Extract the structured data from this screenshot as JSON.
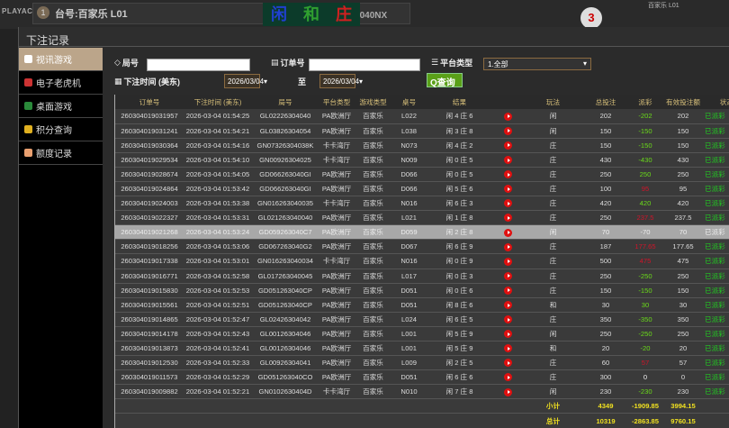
{
  "background": {
    "logo": "PLAYACE",
    "table_no": "1",
    "table_name": "台号:百家乐 L01",
    "round_no": "游戏局号:GL001263040NX",
    "tiles": [
      "闲",
      "和",
      "庄"
    ],
    "countdown": "3",
    "right_table": "百家乐 L01"
  },
  "modal": {
    "title": "下注记录"
  },
  "sidebar": {
    "items": [
      {
        "label": "视讯游戏",
        "icon": "cards-icon",
        "active": true
      },
      {
        "label": "电子老虎机",
        "icon": "slot-icon"
      },
      {
        "label": "桌面游戏",
        "icon": "dice-icon"
      },
      {
        "label": "积分查询",
        "icon": "diamond-icon"
      },
      {
        "label": "额度记录",
        "icon": "document-icon"
      }
    ]
  },
  "filters": {
    "round_label": "局号",
    "round_value": "",
    "order_label": "订单号",
    "order_value": "",
    "platform_label": "平台类型",
    "platform_value": "1.全部",
    "time_label": "下注时间 (美东)",
    "date_from": "2026/03/04",
    "date_to": "2026/03/04",
    "to_label": "至",
    "query_label": "查询"
  },
  "colors": {
    "positive": "#6adb1a",
    "negative": "#d0142a",
    "header": "#d8c07a",
    "status": "#22cc22",
    "query": "#5aa018"
  },
  "table": {
    "headers": [
      "订单号",
      "下注时间 (美东)",
      "局号",
      "平台类型",
      "游戏类型",
      "桌号",
      "结果",
      "",
      "玩法",
      "总投注",
      "派彩",
      "有效投注额",
      "状态"
    ],
    "rows": [
      [
        "260304019031957",
        "2026-03-04 01:54:25",
        "GL02226304040",
        "PA欧洲厅",
        "百家乐",
        "L022",
        "闲 4 庄 6",
        "闲",
        "202",
        "-202",
        "202",
        "已派彩",
        "pos"
      ],
      [
        "260304019031241",
        "2026-03-04 01:54:21",
        "GL03826304054",
        "PA欧洲厅",
        "百家乐",
        "L038",
        "闲 3 庄 8",
        "闲",
        "150",
        "-150",
        "150",
        "已派彩",
        "pos"
      ],
      [
        "260304019030364",
        "2026-03-04 01:54:16",
        "GN07326304038K",
        "卡卡湾厅",
        "百家乐",
        "N073",
        "闲 4 庄 2",
        "庄",
        "150",
        "-150",
        "150",
        "已派彩",
        "pos"
      ],
      [
        "260304019029534",
        "2026-03-04 01:54:10",
        "GN00926304025",
        "卡卡湾厅",
        "百家乐",
        "N009",
        "闲 0 庄 5",
        "庄",
        "430",
        "-430",
        "430",
        "已派彩",
        "pos"
      ],
      [
        "260304019028674",
        "2026-03-04 01:54:05",
        "GD066263040GI",
        "PA欧洲厅",
        "百家乐",
        "D066",
        "闲 0 庄 5",
        "庄",
        "250",
        "250",
        "250",
        "已派彩",
        "pos"
      ],
      [
        "260304019024864",
        "2026-03-04 01:53:42",
        "GD066263040GI",
        "PA欧洲厅",
        "百家乐",
        "D066",
        "闲 5 庄 6",
        "庄",
        "100",
        "95",
        "95",
        "已派彩",
        "neg"
      ],
      [
        "260304019024003",
        "2026-03-04 01:53:38",
        "GN016263040035",
        "卡卡湾厅",
        "百家乐",
        "N016",
        "闲 6 庄 3",
        "庄",
        "420",
        "420",
        "420",
        "已派彩",
        "pos"
      ],
      [
        "260304019022327",
        "2026-03-04 01:53:31",
        "GL021263040040",
        "PA欧洲厅",
        "百家乐",
        "L021",
        "闲 1 庄 8",
        "庄",
        "250",
        "237.5",
        "237.5",
        "已派彩",
        "neg"
      ],
      [
        "260304019021268",
        "2026-03-04 01:53:24",
        "GD059263040C7",
        "PA欧洲厅",
        "百家乐",
        "D059",
        "闲 2 庄 8",
        "闲",
        "70",
        "-70",
        "70",
        "已派彩",
        "pos"
      ],
      [
        "260304019018256",
        "2026-03-04 01:53:06",
        "GD067263040G2",
        "PA欧洲厅",
        "百家乐",
        "D067",
        "闲 6 庄 9",
        "庄",
        "187",
        "177.65",
        "177.65",
        "已派彩",
        "neg"
      ],
      [
        "260304019017338",
        "2026-03-04 01:53:01",
        "GN016263040034",
        "卡卡湾厅",
        "百家乐",
        "N016",
        "闲 0 庄 9",
        "庄",
        "500",
        "475",
        "475",
        "已派彩",
        "neg"
      ],
      [
        "260304019016771",
        "2026-03-04 01:52:58",
        "GL017263040045",
        "PA欧洲厅",
        "百家乐",
        "L017",
        "闲 0 庄 3",
        "庄",
        "250",
        "-250",
        "250",
        "已派彩",
        "pos"
      ],
      [
        "260304019015830",
        "2026-03-04 01:52:53",
        "GD051263040CP",
        "PA欧洲厅",
        "百家乐",
        "D051",
        "闲 0 庄 6",
        "庄",
        "150",
        "-150",
        "150",
        "已派彩",
        "pos"
      ],
      [
        "260304019015561",
        "2026-03-04 01:52:51",
        "GD051263040CP",
        "PA欧洲厅",
        "百家乐",
        "D051",
        "闲 8 庄 6",
        "和",
        "30",
        "30",
        "30",
        "已派彩",
        "pos"
      ],
      [
        "260304019014865",
        "2026-03-04 01:52:47",
        "GL02426304042",
        "PA欧洲厅",
        "百家乐",
        "L024",
        "闲 6 庄 5",
        "庄",
        "350",
        "-350",
        "350",
        "已派彩",
        "pos"
      ],
      [
        "260304019014178",
        "2026-03-04 01:52:43",
        "GL00126304046",
        "PA欧洲厅",
        "百家乐",
        "L001",
        "闲 5 庄 9",
        "闲",
        "250",
        "-250",
        "250",
        "已派彩",
        "pos"
      ],
      [
        "260304019013873",
        "2026-03-04 01:52:41",
        "GL00126304046",
        "PA欧洲厅",
        "百家乐",
        "L001",
        "闲 5 庄 9",
        "和",
        "20",
        "-20",
        "20",
        "已派彩",
        "pos"
      ],
      [
        "260304019012530",
        "2026-03-04 01:52:33",
        "GL00926304041",
        "PA欧洲厅",
        "百家乐",
        "L009",
        "闲 2 庄 5",
        "庄",
        "60",
        "57",
        "57",
        "已派彩",
        "neg"
      ],
      [
        "260304019011573",
        "2026-03-04 01:52:29",
        "GD051263040CO",
        "PA欧洲厅",
        "百家乐",
        "D051",
        "闲 6 庄 6",
        "庄",
        "300",
        "0",
        "0",
        "已派彩",
        "neu"
      ],
      [
        "260304019009882",
        "2026-03-04 01:52:21",
        "GN0102630404D",
        "卡卡湾厅",
        "百家乐",
        "N010",
        "闲 7 庄 8",
        "闲",
        "230",
        "-230",
        "230",
        "已派彩",
        "pos"
      ]
    ],
    "selected_row": 8,
    "subtotal": {
      "label": "小计",
      "total_bet": "4349",
      "payout": "-1909.85",
      "valid_bet": "3994.15"
    },
    "total": {
      "label": "总计",
      "total_bet": "10319",
      "payout": "-2863.85",
      "valid_bet": "9760.15"
    }
  }
}
